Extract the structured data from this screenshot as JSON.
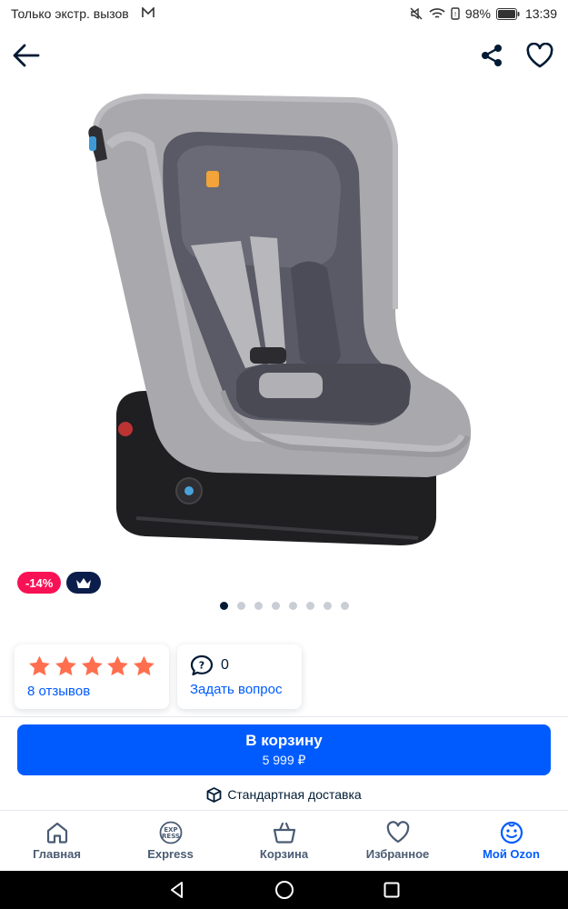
{
  "status_bar": {
    "carrier": "Только экстр. вызов",
    "battery": "98%",
    "time": "13:39"
  },
  "product": {
    "badge_discount": "-14%",
    "gallery_count": 8,
    "gallery_active": 0
  },
  "rating": {
    "stars": 5,
    "reviews_link": "8 отзывов"
  },
  "questions": {
    "count": "0",
    "ask_link": "Задать вопрос"
  },
  "cart": {
    "label": "В корзину",
    "price": "5 999 ₽"
  },
  "delivery": {
    "label": "Стандартная доставка"
  },
  "tabbar": {
    "tabs": [
      {
        "label": "Главная",
        "icon": "home-icon"
      },
      {
        "label": "Express",
        "icon": "express-icon"
      },
      {
        "label": "Корзина",
        "icon": "basket-icon"
      },
      {
        "label": "Избранное",
        "icon": "heart-icon"
      },
      {
        "label": "Мой Ozon",
        "icon": "profile-icon",
        "active": true
      }
    ]
  },
  "colors": {
    "accent": "#005bff",
    "discount": "#f91155",
    "premium": "#0b1d4a",
    "star": "#ff6f4f"
  }
}
